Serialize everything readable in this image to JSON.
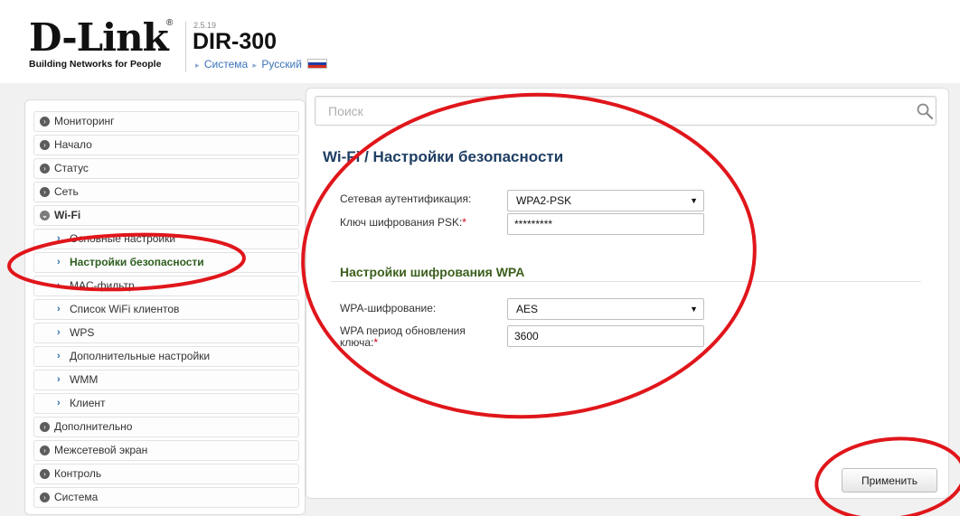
{
  "header": {
    "logo_word": "D-Link",
    "logo_reg": "®",
    "logo_tagline": "Building Networks for People",
    "firmware_version": "2.5.19",
    "model": "DIR-300",
    "breadcrumb": {
      "sep": "▸",
      "system": "Система",
      "language": "Русский"
    }
  },
  "sidebar": {
    "items": [
      {
        "label": "Мониторинг",
        "level": 0
      },
      {
        "label": "Начало",
        "level": 0
      },
      {
        "label": "Статус",
        "level": 0
      },
      {
        "label": "Сеть",
        "level": 0
      },
      {
        "label": "Wi-Fi",
        "level": 0,
        "expanded": true
      },
      {
        "label": "Основные настройки",
        "level": 1
      },
      {
        "label": "Настройки безопасности",
        "level": 1,
        "active": true
      },
      {
        "label": "MAC-фильтр",
        "level": 1
      },
      {
        "label": "Список WiFi клиентов",
        "level": 1
      },
      {
        "label": "WPS",
        "level": 1
      },
      {
        "label": "Дополнительные настройки",
        "level": 1
      },
      {
        "label": "WMM",
        "level": 1
      },
      {
        "label": "Клиент",
        "level": 1
      },
      {
        "label": "Дополнительно",
        "level": 0
      },
      {
        "label": "Межсетевой экран",
        "level": 0
      },
      {
        "label": "Контроль",
        "level": 0
      },
      {
        "label": "Система",
        "level": 0
      }
    ]
  },
  "search": {
    "placeholder": "Поиск",
    "value": ""
  },
  "page": {
    "title": "Wi-Fi /  Настройки безопасности",
    "auth": {
      "label": "Сетевая аутентификация:",
      "value": "WPA2-PSK"
    },
    "psk": {
      "label": "Ключ шифрования PSK:",
      "required_mark": "*",
      "value": "*********"
    },
    "wpa_section_title": "Настройки шифрования WPA",
    "wpa_encryption": {
      "label": "WPA-шифрование:",
      "value": "AES"
    },
    "wpa_period": {
      "label_line1": "WPA период обновления",
      "label_line2": "ключа:",
      "required_mark": "*",
      "value": "3600"
    },
    "apply_label": "Применить"
  },
  "colors": {
    "annotation_red": "#e0161b",
    "title_blue": "#1f3f63",
    "section_green": "#3b5f1c",
    "link_blue": "#3b74b8"
  },
  "icons": {
    "search": "search-icon",
    "dropdown": "chevron-down-icon",
    "nav_bullet": "circle-chevron-icon",
    "nav_sub_arrow": "chevron-right-icon",
    "flag": "russian-flag-icon"
  }
}
